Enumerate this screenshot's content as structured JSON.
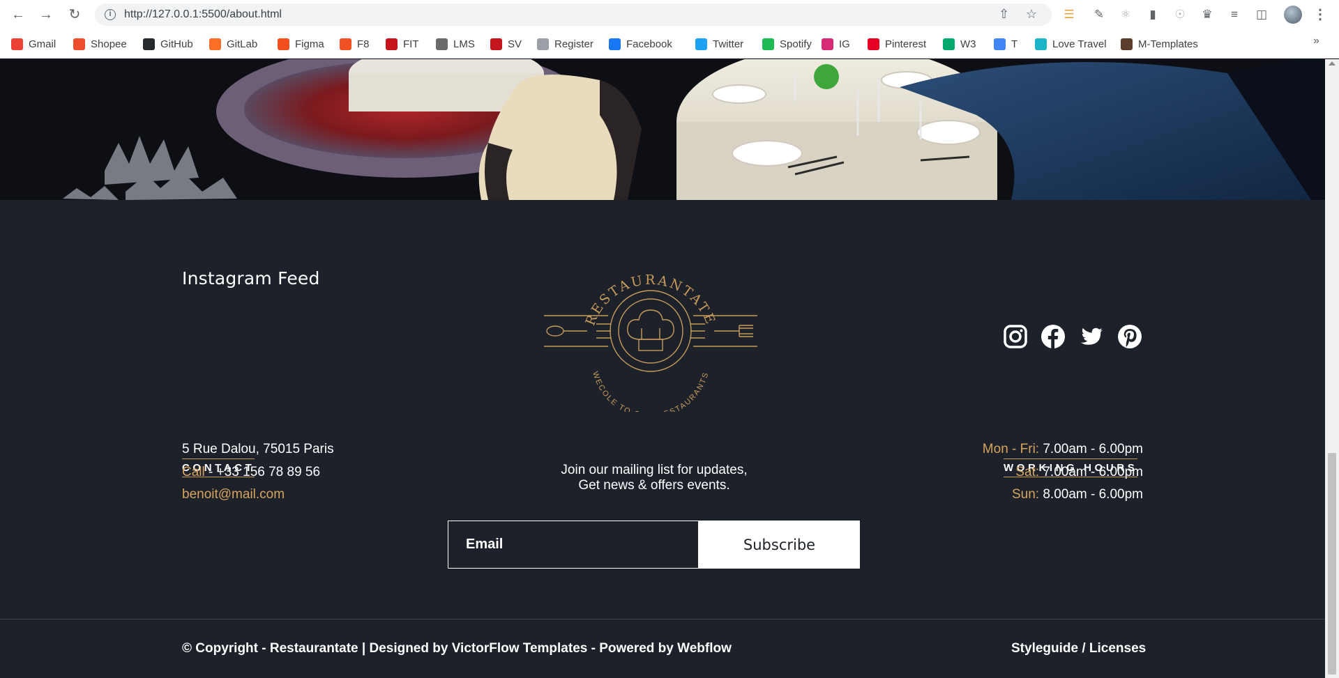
{
  "browser": {
    "url": "http://127.0.0.1:5500/about.html",
    "bookmarks": [
      {
        "label": "Gmail",
        "icon": "gmail-icon",
        "color": "#ea4335"
      },
      {
        "label": "Shopee",
        "icon": "shopee-icon",
        "color": "#ee4d2d"
      },
      {
        "label": "GitHub",
        "icon": "github-icon",
        "color": "#24292e"
      },
      {
        "label": "GitLab",
        "icon": "gitlab-icon",
        "color": "#fc6d26"
      },
      {
        "label": "Figma",
        "icon": "figma-icon",
        "color": "#f24e1e"
      },
      {
        "label": "F8",
        "icon": "f8-icon",
        "color": "#f05123"
      },
      {
        "label": "FIT",
        "icon": "fit-icon",
        "color": "#c4161c"
      },
      {
        "label": "LMS",
        "icon": "lms-icon",
        "color": "#6b6b6b"
      },
      {
        "label": "SV",
        "icon": "sv-icon",
        "color": "#c4161c"
      },
      {
        "label": "Register",
        "icon": "register-icon",
        "color": "#9aa0a6"
      },
      {
        "label": "Facebook",
        "icon": "facebook-icon",
        "color": "#1877f2"
      },
      {
        "label": "Twitter",
        "icon": "twitter-icon",
        "color": "#1da1f2"
      },
      {
        "label": "Spotify",
        "icon": "spotify-icon",
        "color": "#1db954"
      },
      {
        "label": "IG",
        "icon": "instagram-icon",
        "color": "#d62976"
      },
      {
        "label": "Pinterest",
        "icon": "pinterest-icon",
        "color": "#e60023"
      },
      {
        "label": "W3",
        "icon": "w3-icon",
        "color": "#04aa6d"
      },
      {
        "label": "T",
        "icon": "translate-icon",
        "color": "#4285f4"
      },
      {
        "label": "Love Travel",
        "icon": "love-travel-icon",
        "color": "#1ab3c7"
      },
      {
        "label": "M-Templates",
        "icon": "m-templates-icon",
        "color": "#5a3e2b"
      }
    ]
  },
  "footer": {
    "instagram_title": "Instagram Feed",
    "logo": {
      "top_text": "RESTAURANTATE",
      "bottom_text": "WECOLE TO OUR RESTAURANTS"
    },
    "social": [
      "instagram-icon",
      "facebook-icon",
      "twitter-icon",
      "pinterest-icon"
    ],
    "contact": {
      "label": "CONTACT",
      "address": "5 Rue Dalou, 75015 Paris",
      "call_label": "Call",
      "call_number": " - +33 156 78 89 56",
      "email": "benoit@mail.com"
    },
    "newsletter": {
      "line1": "Join our mailing list for updates,",
      "line2": "Get news & offers events.",
      "placeholder": "Email",
      "button": "Subscribe"
    },
    "hours": {
      "label": "WORKING HOURS",
      "rows": [
        {
          "day": "Mon - Fri:",
          "time": " 7.00am - 6.00pm"
        },
        {
          "day": "Sat:",
          "time": " 7.00am - 6.00pm"
        },
        {
          "day": "Sun:",
          "time": " 8.00am - 6.00pm"
        }
      ]
    },
    "copyright": "© Copyright - Restaurantate | Designed by VictorFlow Templates - Powered by Webflow",
    "styleguide": "Styleguide / Licenses"
  },
  "colors": {
    "background": "#1c212a",
    "accent_gold": "#d9a45c"
  }
}
